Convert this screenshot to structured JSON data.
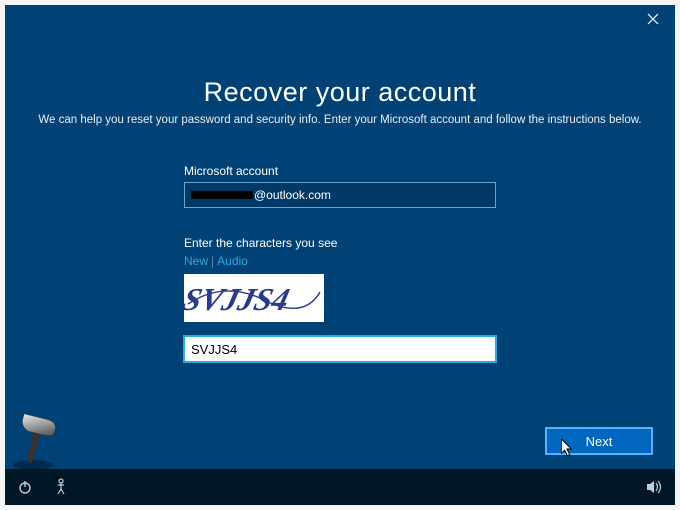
{
  "titlebar": {
    "close_label": "Close"
  },
  "page": {
    "heading": "Recover your account",
    "subtext": "We can help you reset your password and security info. Enter your Microsoft account and follow the instructions below."
  },
  "form": {
    "account_label": "Microsoft account",
    "account_value_suffix": "@outlook.com",
    "captcha_label": "Enter the characters you see",
    "captcha_link_new": "New",
    "captcha_link_audio": "Audio",
    "captcha_image_text": "SVJJS4",
    "captcha_input_value": "SVJJS4"
  },
  "actions": {
    "next_label": "Next"
  },
  "taskbar": {
    "power_label": "Power",
    "ease_label": "Ease of access",
    "volume_label": "Volume"
  },
  "colors": {
    "bg": "#004275",
    "accent": "#0067c0",
    "link": "#2ca9e1"
  }
}
